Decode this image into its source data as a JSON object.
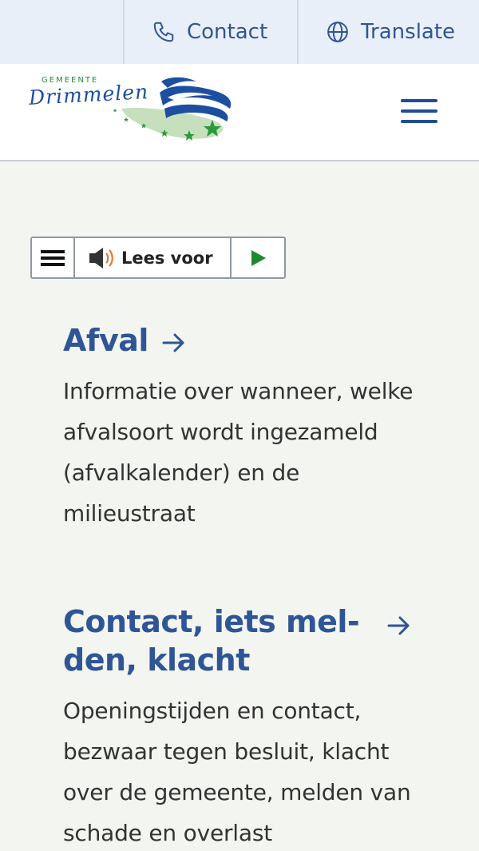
{
  "topbar": {
    "contact_label": "Contact",
    "contact_icon": "phone-icon",
    "translate_label": "Translate",
    "translate_icon": "globe-icon"
  },
  "header": {
    "logo": {
      "small_text": "GEMEENTE",
      "name": "Drimmelen"
    },
    "menu_icon": "hamburger-menu-icon"
  },
  "readspeaker": {
    "menu_icon": "menu-icon",
    "speaker_icon": "speaker-icon",
    "label": "Lees voor",
    "play_icon": "play-icon"
  },
  "sections": [
    {
      "title": "Afval",
      "description": "Informatie over wanneer, welke afvalsoort wordt ingezameld (afvalkalender) en de milieustraat"
    },
    {
      "title_line1": "Contact, iets mel-",
      "title_line2": "den, klacht",
      "description": "Openingstijden en contact, bezwaar tegen besluit, klacht over de gemeente, melden van schade en overlast"
    }
  ],
  "colors": {
    "accent": "#2f5597",
    "topbar_bg": "#e9eff8",
    "page_bg": "#f3f5f0",
    "play_green": "#1e8a2e"
  }
}
